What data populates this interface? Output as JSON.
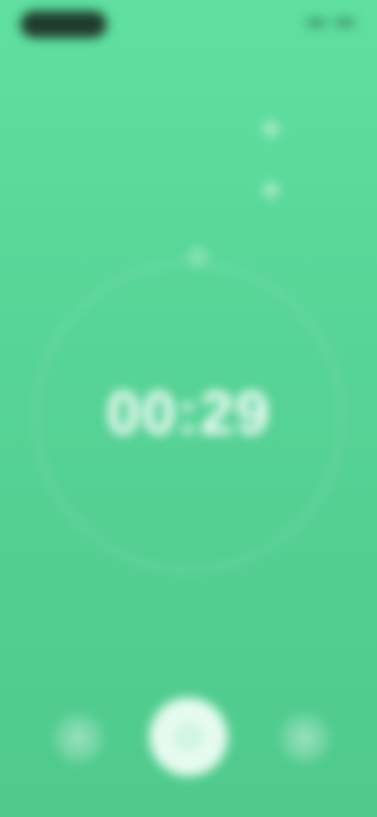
{
  "header": {
    "title": ""
  },
  "settings": [
    {
      "label": "",
      "value": ""
    },
    {
      "label": "",
      "value": ""
    }
  ],
  "timer": {
    "phase_label": "",
    "display": "00:29",
    "sub_label": ""
  },
  "action": {
    "label": ""
  },
  "icons": {
    "plus": "plus-icon",
    "center": "small-settings-icon",
    "left": "reset-icon",
    "main": "play-icon",
    "right": "skip-icon"
  },
  "colors": {
    "background": "#56d396",
    "main_button": "#e6fbef",
    "status_pill": "#1f3b2b"
  }
}
